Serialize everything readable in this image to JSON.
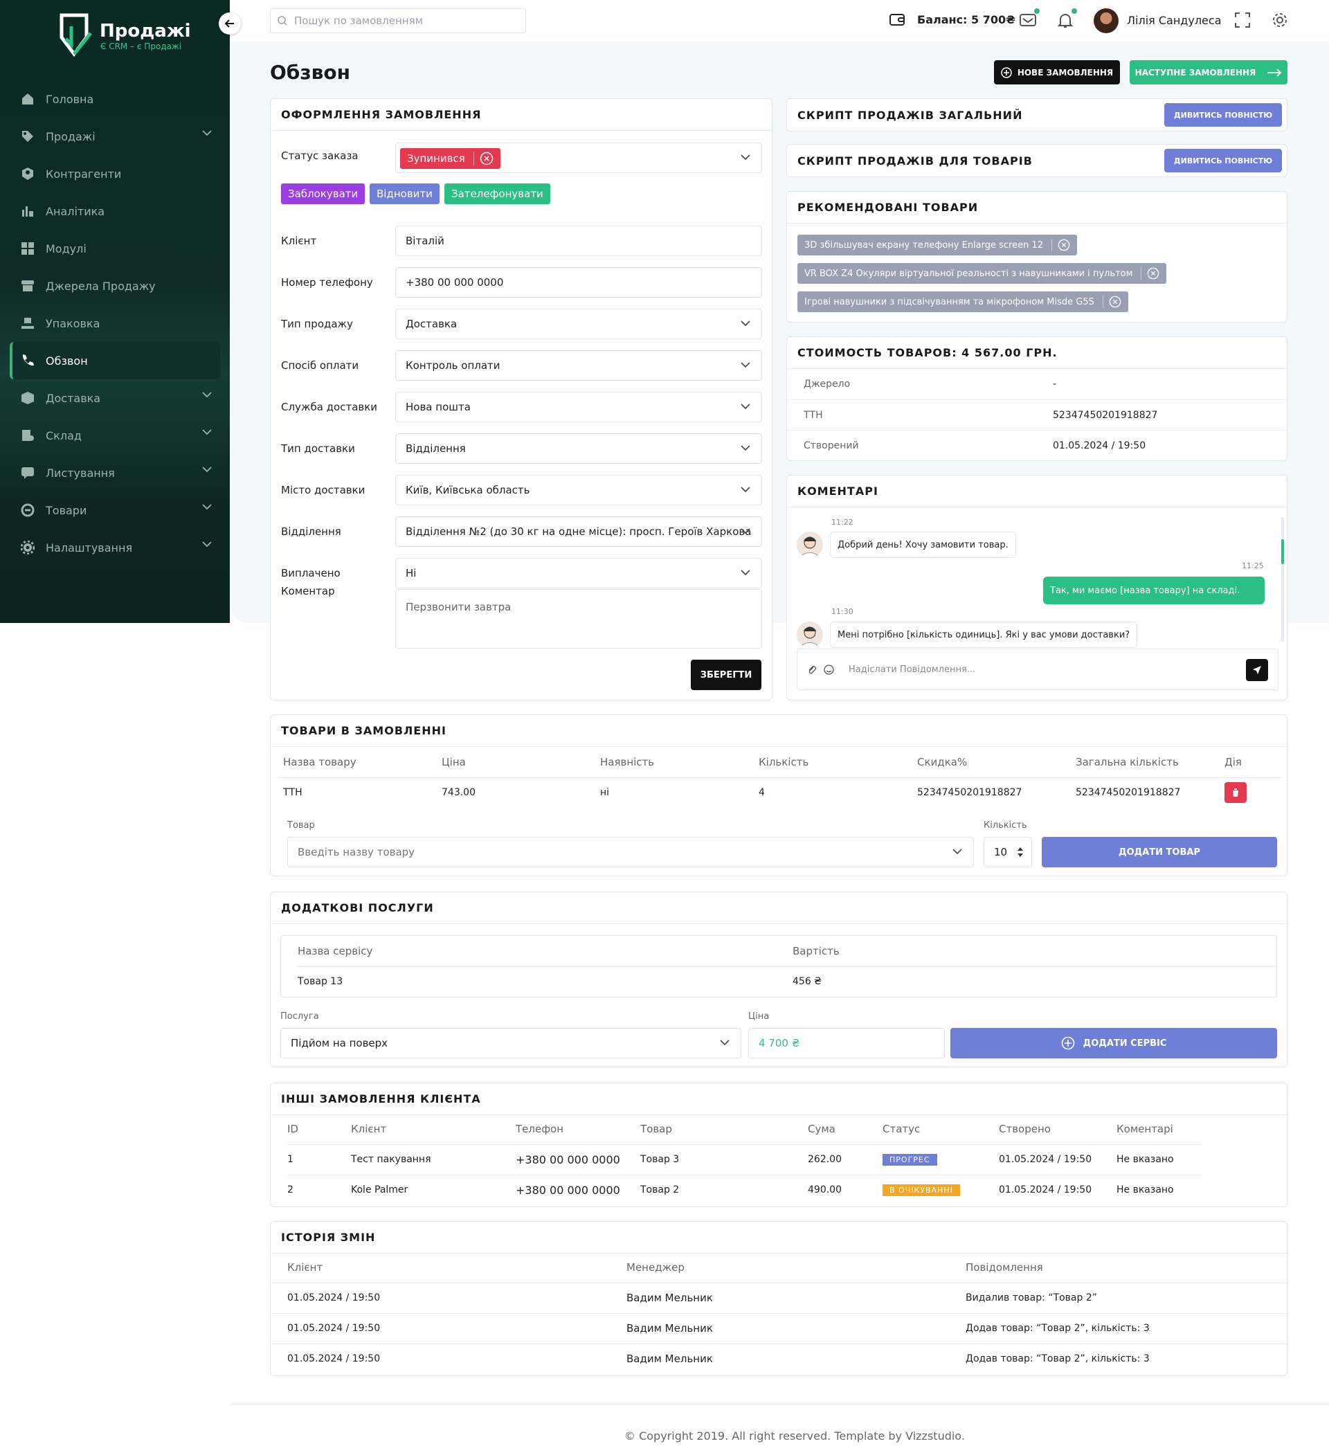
{
  "app": {
    "name": "Продажі",
    "tagline": "Є CRM – є Продажі"
  },
  "sidebar": {
    "items": [
      {
        "label": "Головна",
        "icon": "home-icon",
        "chevron": false,
        "active": false
      },
      {
        "label": "Продажі",
        "icon": "tag-icon",
        "chevron": true,
        "active": false
      },
      {
        "label": "Контрагенти",
        "icon": "user-circle-icon",
        "chevron": false,
        "active": false
      },
      {
        "label": "Аналітика",
        "icon": "chart-icon",
        "chevron": false,
        "active": false
      },
      {
        "label": "Модулі",
        "icon": "grid-icon",
        "chevron": false,
        "active": false
      },
      {
        "label": "Джерела Продажу",
        "icon": "store-icon",
        "chevron": false,
        "active": false
      },
      {
        "label": "Упаковка",
        "icon": "box-hands-icon",
        "chevron": false,
        "active": false
      },
      {
        "label": "Обзвон",
        "icon": "phone-icon",
        "chevron": false,
        "active": true
      },
      {
        "label": "Доставка",
        "icon": "cube-icon",
        "chevron": true,
        "active": false
      },
      {
        "label": "Склад",
        "icon": "warehouse-icon",
        "chevron": true,
        "active": false
      },
      {
        "label": "Листування",
        "icon": "chat-icon",
        "chevron": true,
        "active": false
      },
      {
        "label": "Товари",
        "icon": "goods-icon",
        "chevron": true,
        "active": false
      },
      {
        "label": "Налаштування",
        "icon": "gear-icon",
        "chevron": true,
        "active": false
      }
    ]
  },
  "topbar": {
    "search_placeholder": "Пошук по замовленням",
    "balance": "Баланс: 5 700₴",
    "user": "Лілія Сандулеса"
  },
  "page": {
    "title": "Обзвон",
    "new_order": "НОВЕ ЗАМОВЛЕННЯ",
    "next_order": "НАСТУПНЕ ЗАМОВЛЕННЯ"
  },
  "order_form": {
    "title": "ОФОРМЛЕННЯ ЗАМОВЛЕННЯ",
    "status_label": "Статус заказа",
    "status_value": "Зупинився",
    "actions": [
      "Заблокувати",
      "Відновити",
      "Зателефонувати"
    ],
    "fields": [
      {
        "label": "Клієнт",
        "value": "Віталій",
        "select": false
      },
      {
        "label": "Номер телефону",
        "value": "+380 00 000 0000",
        "select": false
      },
      {
        "label": "Тип продажу",
        "value": "Доставка",
        "select": true
      },
      {
        "label": "Спосіб оплати",
        "value": "Контроль оплати",
        "select": true
      },
      {
        "label": "Служба доставки",
        "value": "Нова пошта",
        "select": true
      },
      {
        "label": "Тип доставки",
        "value": "Відділення",
        "select": true
      },
      {
        "label": "Місто доставки",
        "value": "Київ, Київська область",
        "select": true
      },
      {
        "label": "Відділення",
        "value": "Відділення №2 (до 30 кг на одне місце): просп. Героїв Харкова",
        "select": true
      },
      {
        "label": "Виплачено",
        "value": "Ні",
        "select": true
      }
    ],
    "comment_label": "Коментар",
    "comment_placeholder": "Перзвонити завтра",
    "save": "ЗБЕРЕГТИ"
  },
  "scripts": {
    "general": "СКРИПТ ПРОДАЖІВ ЗАГАЛЬНИЙ",
    "products": "СКРИПТ ПРОДАЖІВ ДЛЯ ТОВАРІВ",
    "view": "ДИВИТИСЬ ПОВНІСТЮ"
  },
  "recommended": {
    "title": "РЕКОМЕНДОВАНІ ТОВАРИ",
    "items": [
      "3D збільшувач екрану телефону Enlarge screen 12",
      "VR BOX Z4 Окуляри віртуальної реальності з навушниками і пультом",
      "Ігрові навушники з підсвічуванням та мікрофоном Misde G5S"
    ]
  },
  "cost": {
    "title": "СТОИМОСТЬ ТОВАРОВ: 4 567.00 ГРН.",
    "rows": [
      {
        "k": "Джерело",
        "v": "-"
      },
      {
        "k": "ТТН",
        "v": "52347450201918827"
      },
      {
        "k": "Створений",
        "v": "01.05.2024 / 19:50"
      }
    ]
  },
  "comments": {
    "title": "КОМЕНТАРІ",
    "messages": [
      {
        "time": "11:22",
        "text": "Добрий день! Хочу замовити товар.",
        "me": false
      },
      {
        "time": "11:25",
        "text": "Так, ми маємо [назва товару] на складі.",
        "me": true
      },
      {
        "time": "11:30",
        "text": "Мені потрібно [кількість одиниць]. Які у вас умови доставки?",
        "me": false
      }
    ],
    "placeholder": "Надіслати Повідомлення..."
  },
  "order_items": {
    "title": "ТОВАРИ В ЗАМОВЛЕННІ",
    "columns": [
      "Назва товару",
      "Ціна",
      "Наявність",
      "Кількість",
      "Скидка%",
      "Загальна кількість",
      "Дія"
    ],
    "rows": [
      [
        "ТТН",
        "743.00",
        "ні",
        "4",
        "52347450201918827",
        "52347450201918827"
      ]
    ],
    "product_label": "Товар",
    "product_placeholder": "Введіть назву товару",
    "qty_label": "Кількість",
    "qty_value": "10",
    "add": "ДОДАТИ ТОВАР"
  },
  "services": {
    "title": "ДОДАТКОВІ ПОСЛУГИ",
    "columns": [
      "Назва сервісу",
      "Вартість"
    ],
    "rows": [
      [
        "Товар 13",
        "456 ₴"
      ]
    ],
    "service_label": "Послуга",
    "service_value": "Підйом на поверх",
    "price_label": "Ціна",
    "price_value": "4 700 ₴",
    "add": "ДОДАТИ СЕРВІС"
  },
  "other_orders": {
    "title": "ІНШІ ЗАМОВЛЕННЯ КЛІЄНТА",
    "columns": [
      "ID",
      "Клієнт",
      "Телефон",
      "Товар",
      "Сума",
      "Статус",
      "Створено",
      "Коментарі"
    ],
    "rows": [
      [
        "1",
        "Тест пакування",
        "+380 00 000 0000",
        "Товар 3",
        "262.00",
        "ПРОГРЕС",
        "01.05.2024 / 19:50",
        "Не вказано"
      ],
      [
        "2",
        "Kole Palmer",
        "+380 00 000 0000",
        "Товар 2",
        "490.00",
        "В ОЧІКУВАННІ",
        "01.05.2024 / 19:50",
        "Не вказано"
      ]
    ],
    "status_colors": {
      "ПРОГРЕС": "#6f7fd8",
      "В ОЧІКУВАННІ": "#f5a623"
    }
  },
  "history": {
    "title": "ІСТОРІЯ ЗМІН",
    "columns": [
      "Клієнт",
      "Менеджер",
      "Повідомлення"
    ],
    "rows": [
      [
        "01.05.2024 / 19:50",
        "Вадим Мельник",
        "Видалив товар: “Товар 2”"
      ],
      [
        "01.05.2024 / 19:50",
        "Вадим Мельник",
        "Додав товар: “Товар 2”, кількість: 3"
      ],
      [
        "01.05.2024 / 19:50",
        "Вадим Мельник",
        "Додав товар: “Товар 2”, кількість: 3"
      ]
    ]
  },
  "footer": "© Copyright 2019. All right reserved. Template by Vizzstudio.",
  "colors": {
    "primary_green": "#2cbf84",
    "indigo": "#6f7fd8",
    "red": "#e53950",
    "purple": "#9b3fe0",
    "dark": "#111111"
  }
}
